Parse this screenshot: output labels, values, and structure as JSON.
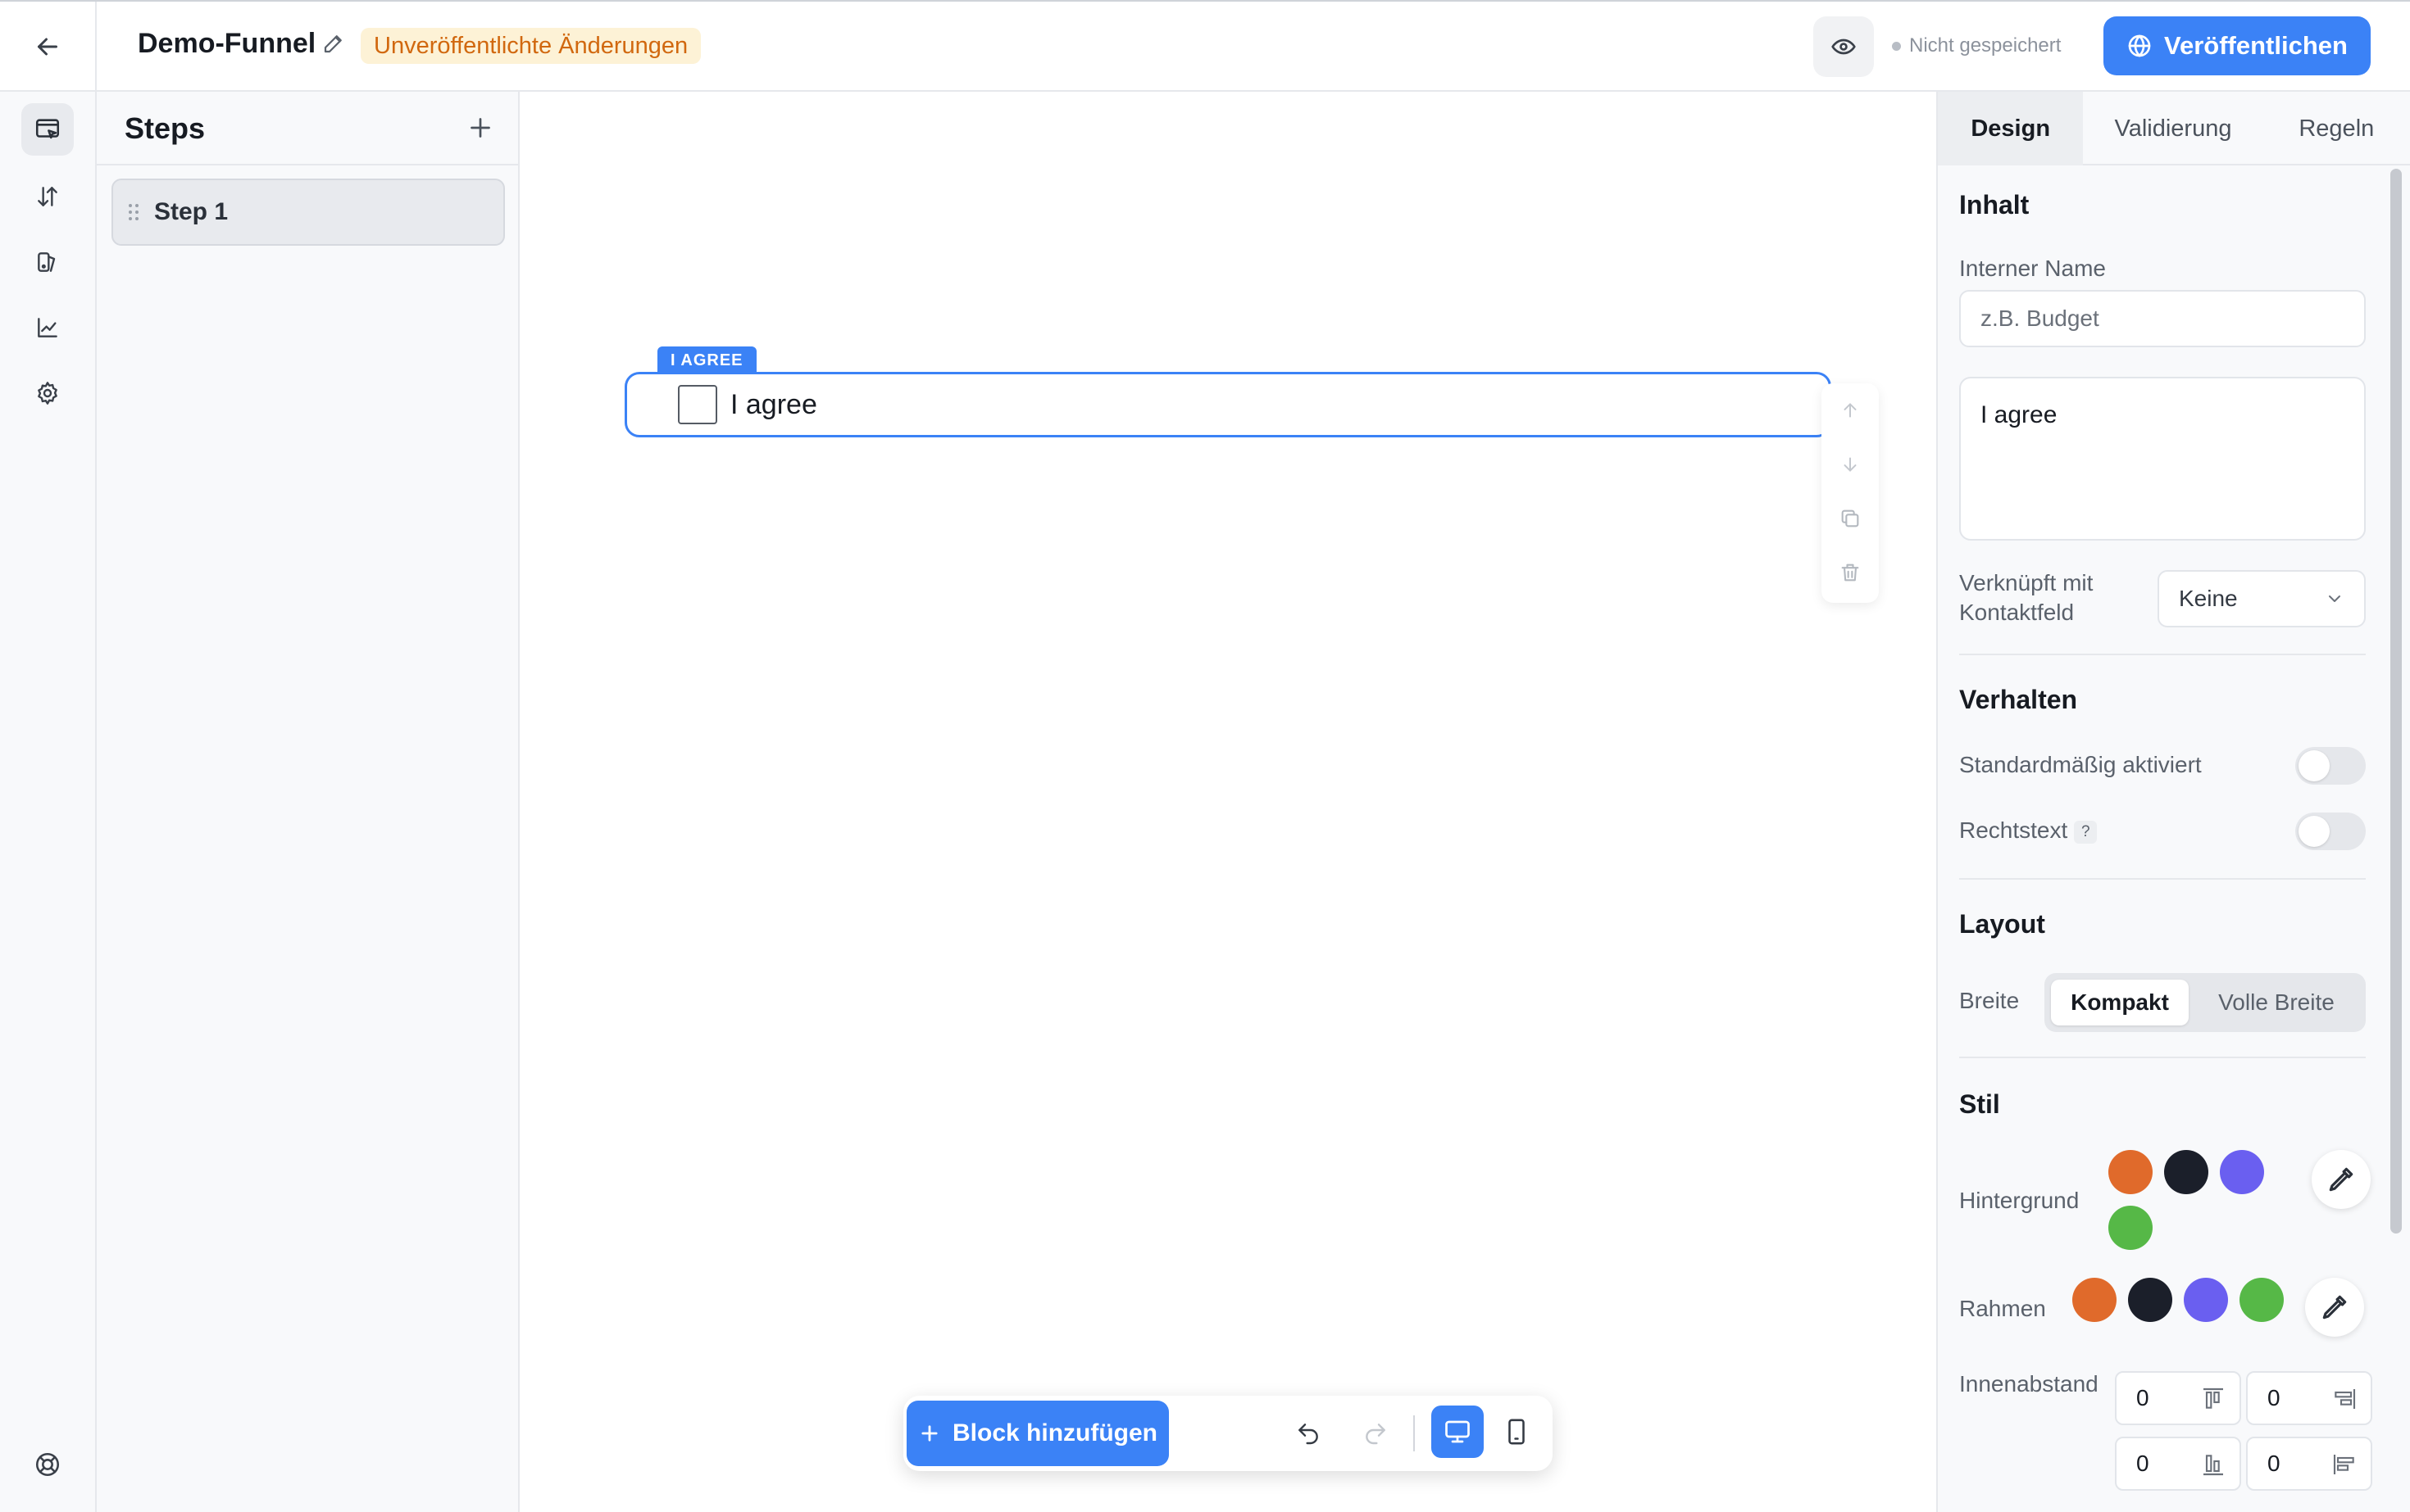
{
  "header": {
    "funnel_title": "Demo-Funnel",
    "unsaved_badge": "Unveröffentlichte Änderungen",
    "save_status": "Nicht gespeichert",
    "publish_label": "Veröffentlichen"
  },
  "rail": {
    "items": [
      {
        "icon": "editor-icon",
        "active": true
      },
      {
        "icon": "sort-arrows-icon",
        "active": false
      },
      {
        "icon": "theme-icon",
        "active": false
      },
      {
        "icon": "analytics-icon",
        "active": false
      },
      {
        "icon": "gear-icon",
        "active": false
      }
    ],
    "bottom_icon": "help-lifebuoy-icon"
  },
  "steps": {
    "title": "Steps",
    "items": [
      {
        "label": "Step 1"
      }
    ]
  },
  "canvas": {
    "block_tag": "I AGREE",
    "block_label": "I agree",
    "add_block_label": "Block hinzufügen"
  },
  "props": {
    "tabs": [
      {
        "label": "Design",
        "active": true
      },
      {
        "label": "Validierung",
        "active": false
      },
      {
        "label": "Regeln",
        "active": false
      }
    ],
    "content_title": "Inhalt",
    "internal_name_label": "Interner Name",
    "internal_name_placeholder": "z.B. Budget",
    "text_value": "I agree",
    "linked_label": "Verknüpft mit Kontaktfeld",
    "linked_value": "Keine",
    "behavior_title": "Verhalten",
    "default_enabled_label": "Standardmäßig aktiviert",
    "default_enabled": false,
    "legal_text_label": "Rechtstext",
    "legal_text_help": "?",
    "legal_text": false,
    "layout_title": "Layout",
    "width_label": "Breite",
    "width_options": [
      "Kompakt",
      "Volle Breite"
    ],
    "width_selected": "Kompakt",
    "style_title": "Stil",
    "background_label": "Hintergrund",
    "background_colors": [
      "#e06a2b",
      "#1b1f2a",
      "#6a5ff0",
      "#56b847"
    ],
    "border_label": "Rahmen",
    "border_colors": [
      "#e06a2b",
      "#1b1f2a",
      "#6a5ff0",
      "#56b847"
    ],
    "padding_label": "Innenabstand",
    "padding": {
      "top": "0",
      "right": "0",
      "bottom": "0",
      "left": "0"
    }
  },
  "colors": {
    "accent": "#3b82f6",
    "badge_bg": "#fdf2d6",
    "badge_text": "#d1680f"
  }
}
